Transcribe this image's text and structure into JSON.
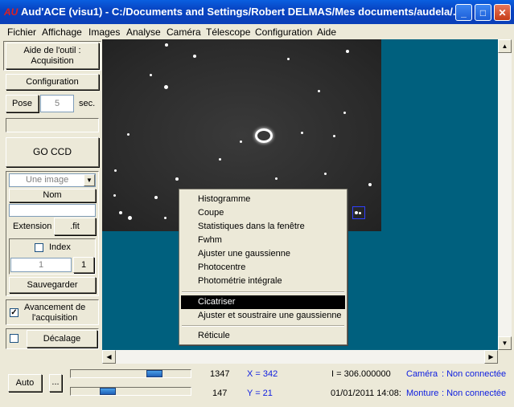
{
  "window": {
    "app_icon": "AU",
    "title": "Aud'ACE (visu1) - C:/Documents and Settings/Robert DELMAS/Mes documents/audela/...",
    "minimize": "_",
    "maximize": "□",
    "close": "✕"
  },
  "menu": [
    "Fichier",
    "Affichage",
    "Images",
    "Analyse",
    "Caméra",
    "Télescope",
    "Configuration",
    "Aide"
  ],
  "panel": {
    "help_button": "Aide de l'outil :\nAcquisition",
    "config_button": "Configuration",
    "pose_button": "Pose",
    "pose_value": "5",
    "pose_unit": "sec.",
    "status_field": "",
    "go_button": "GO CCD",
    "mode_select": "Une image",
    "nom_button": "Nom",
    "nom_value": "",
    "extension_label": "Extension",
    "extension_button": ".fit",
    "index_checkbox_label": "Index",
    "index_checked": false,
    "index_value": "1",
    "index_button": "1",
    "save_button": "Sauvegarder",
    "progress_checkbox_label": "Avancement de\nl'acquisition",
    "progress_checked": true,
    "offset_checked": false,
    "offset_button": "Décalage"
  },
  "context_menu": {
    "group1": [
      "Histogramme",
      "Coupe",
      "Statistiques dans la fenêtre",
      "Fwhm",
      "Ajuster une gaussienne",
      "Photocentre",
      "Photométrie intégrale"
    ],
    "group2": [
      "Cicatriser",
      "Ajuster et soustraire une gaussienne"
    ],
    "group3": [
      "Réticule"
    ],
    "selected": "Cicatriser"
  },
  "bottom": {
    "auto_button": "Auto",
    "more_button": "...",
    "slider1_value": "1347",
    "slider2_value": "147",
    "slider1_level": 0.73,
    "slider2_level": 0.28,
    "x_readout": "X = 342",
    "y_readout": "Y = 21",
    "intensity": "I = 306.000000",
    "datetime": "01/01/2011 14:08:",
    "camera_label": "Caméra",
    "camera_status": ": Non connectée",
    "mount_label": "Monture",
    "mount_status": ": Non connectée"
  },
  "colors": {
    "viewport_bg": "#00607e",
    "title_bar": "#0844c2",
    "readout_blue": "#1020e0"
  }
}
